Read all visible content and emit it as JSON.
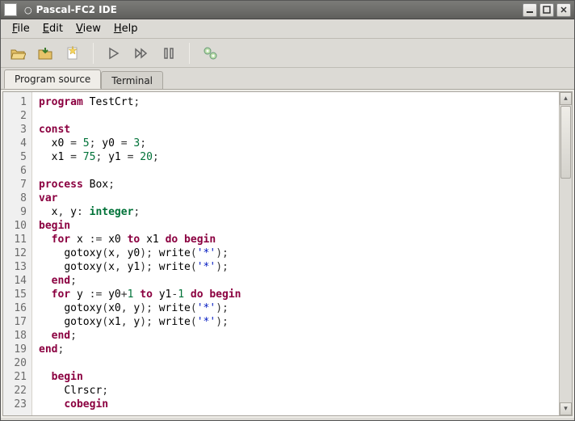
{
  "window": {
    "title": "Pascal-FC2 IDE"
  },
  "menu": {
    "file": "File",
    "edit": "Edit",
    "view": "View",
    "help": "Help"
  },
  "toolbar_icons": {
    "open": "folder-icon",
    "save": "save-icon",
    "new": "new-icon",
    "run": "play-icon",
    "fast": "fastforward-icon",
    "pause": "pause-icon",
    "settings": "gears-icon"
  },
  "tabs": {
    "source": "Program source",
    "terminal": "Terminal"
  },
  "code": {
    "lines": [
      {
        "n": "1",
        "tokens": [
          [
            "kw",
            "program"
          ],
          [
            "sp",
            " "
          ],
          [
            "id",
            "TestCrt"
          ],
          [
            "pun",
            ";"
          ]
        ]
      },
      {
        "n": "2",
        "tokens": []
      },
      {
        "n": "3",
        "tokens": [
          [
            "kw",
            "const"
          ]
        ]
      },
      {
        "n": "4",
        "tokens": [
          [
            "sp",
            "  "
          ],
          [
            "id",
            "x0"
          ],
          [
            "sp",
            " "
          ],
          [
            "pun",
            "="
          ],
          [
            "sp",
            " "
          ],
          [
            "num",
            "5"
          ],
          [
            "pun",
            ";"
          ],
          [
            "sp",
            " "
          ],
          [
            "id",
            "y0"
          ],
          [
            "sp",
            " "
          ],
          [
            "pun",
            "="
          ],
          [
            "sp",
            " "
          ],
          [
            "num",
            "3"
          ],
          [
            "pun",
            ";"
          ]
        ]
      },
      {
        "n": "5",
        "tokens": [
          [
            "sp",
            "  "
          ],
          [
            "id",
            "x1"
          ],
          [
            "sp",
            " "
          ],
          [
            "pun",
            "="
          ],
          [
            "sp",
            " "
          ],
          [
            "num",
            "75"
          ],
          [
            "pun",
            ";"
          ],
          [
            "sp",
            " "
          ],
          [
            "id",
            "y1"
          ],
          [
            "sp",
            " "
          ],
          [
            "pun",
            "="
          ],
          [
            "sp",
            " "
          ],
          [
            "num",
            "20"
          ],
          [
            "pun",
            ";"
          ]
        ]
      },
      {
        "n": "6",
        "tokens": []
      },
      {
        "n": "7",
        "tokens": [
          [
            "kw",
            "process"
          ],
          [
            "sp",
            " "
          ],
          [
            "id",
            "Box"
          ],
          [
            "pun",
            ";"
          ]
        ]
      },
      {
        "n": "8",
        "tokens": [
          [
            "kw",
            "var"
          ]
        ]
      },
      {
        "n": "9",
        "tokens": [
          [
            "sp",
            "  "
          ],
          [
            "id",
            "x"
          ],
          [
            "pun",
            ","
          ],
          [
            "sp",
            " "
          ],
          [
            "id",
            "y"
          ],
          [
            "pun",
            ":"
          ],
          [
            "sp",
            " "
          ],
          [
            "ty",
            "integer"
          ],
          [
            "pun",
            ";"
          ]
        ]
      },
      {
        "n": "10",
        "tokens": [
          [
            "kw",
            "begin"
          ]
        ]
      },
      {
        "n": "11",
        "tokens": [
          [
            "sp",
            "  "
          ],
          [
            "kw",
            "for"
          ],
          [
            "sp",
            " "
          ],
          [
            "id",
            "x"
          ],
          [
            "sp",
            " "
          ],
          [
            "pun",
            ":="
          ],
          [
            "sp",
            " "
          ],
          [
            "id",
            "x0"
          ],
          [
            "sp",
            " "
          ],
          [
            "kw",
            "to"
          ],
          [
            "sp",
            " "
          ],
          [
            "id",
            "x1"
          ],
          [
            "sp",
            " "
          ],
          [
            "kw",
            "do"
          ],
          [
            "sp",
            " "
          ],
          [
            "kw",
            "begin"
          ]
        ]
      },
      {
        "n": "12",
        "tokens": [
          [
            "sp",
            "    "
          ],
          [
            "id",
            "gotoxy"
          ],
          [
            "pun",
            "("
          ],
          [
            "id",
            "x"
          ],
          [
            "pun",
            ","
          ],
          [
            "sp",
            " "
          ],
          [
            "id",
            "y0"
          ],
          [
            "pun",
            ")"
          ],
          [
            "pun",
            ";"
          ],
          [
            "sp",
            " "
          ],
          [
            "id",
            "write"
          ],
          [
            "pun",
            "("
          ],
          [
            "str",
            "'*'"
          ],
          [
            "pun",
            ")"
          ],
          [
            "pun",
            ";"
          ]
        ]
      },
      {
        "n": "13",
        "tokens": [
          [
            "sp",
            "    "
          ],
          [
            "id",
            "gotoxy"
          ],
          [
            "pun",
            "("
          ],
          [
            "id",
            "x"
          ],
          [
            "pun",
            ","
          ],
          [
            "sp",
            " "
          ],
          [
            "id",
            "y1"
          ],
          [
            "pun",
            ")"
          ],
          [
            "pun",
            ";"
          ],
          [
            "sp",
            " "
          ],
          [
            "id",
            "write"
          ],
          [
            "pun",
            "("
          ],
          [
            "str",
            "'*'"
          ],
          [
            "pun",
            ")"
          ],
          [
            "pun",
            ";"
          ]
        ]
      },
      {
        "n": "14",
        "tokens": [
          [
            "sp",
            "  "
          ],
          [
            "kw",
            "end"
          ],
          [
            "pun",
            ";"
          ]
        ]
      },
      {
        "n": "15",
        "tokens": [
          [
            "sp",
            "  "
          ],
          [
            "kw",
            "for"
          ],
          [
            "sp",
            " "
          ],
          [
            "id",
            "y"
          ],
          [
            "sp",
            " "
          ],
          [
            "pun",
            ":="
          ],
          [
            "sp",
            " "
          ],
          [
            "id",
            "y0"
          ],
          [
            "pun",
            "+"
          ],
          [
            "num",
            "1"
          ],
          [
            "sp",
            " "
          ],
          [
            "kw",
            "to"
          ],
          [
            "sp",
            " "
          ],
          [
            "id",
            "y1"
          ],
          [
            "pun",
            "-"
          ],
          [
            "num",
            "1"
          ],
          [
            "sp",
            " "
          ],
          [
            "kw",
            "do"
          ],
          [
            "sp",
            " "
          ],
          [
            "kw",
            "begin"
          ]
        ]
      },
      {
        "n": "16",
        "tokens": [
          [
            "sp",
            "    "
          ],
          [
            "id",
            "gotoxy"
          ],
          [
            "pun",
            "("
          ],
          [
            "id",
            "x0"
          ],
          [
            "pun",
            ","
          ],
          [
            "sp",
            " "
          ],
          [
            "id",
            "y"
          ],
          [
            "pun",
            ")"
          ],
          [
            "pun",
            ";"
          ],
          [
            "sp",
            " "
          ],
          [
            "id",
            "write"
          ],
          [
            "pun",
            "("
          ],
          [
            "str",
            "'*'"
          ],
          [
            "pun",
            ")"
          ],
          [
            "pun",
            ";"
          ]
        ]
      },
      {
        "n": "17",
        "tokens": [
          [
            "sp",
            "    "
          ],
          [
            "id",
            "gotoxy"
          ],
          [
            "pun",
            "("
          ],
          [
            "id",
            "x1"
          ],
          [
            "pun",
            ","
          ],
          [
            "sp",
            " "
          ],
          [
            "id",
            "y"
          ],
          [
            "pun",
            ")"
          ],
          [
            "pun",
            ";"
          ],
          [
            "sp",
            " "
          ],
          [
            "id",
            "write"
          ],
          [
            "pun",
            "("
          ],
          [
            "str",
            "'*'"
          ],
          [
            "pun",
            ")"
          ],
          [
            "pun",
            ";"
          ]
        ]
      },
      {
        "n": "18",
        "tokens": [
          [
            "sp",
            "  "
          ],
          [
            "kw",
            "end"
          ],
          [
            "pun",
            ";"
          ]
        ]
      },
      {
        "n": "19",
        "tokens": [
          [
            "kw",
            "end"
          ],
          [
            "pun",
            ";"
          ]
        ]
      },
      {
        "n": "20",
        "tokens": []
      },
      {
        "n": "21",
        "tokens": [
          [
            "sp",
            "  "
          ],
          [
            "kw",
            "begin"
          ]
        ]
      },
      {
        "n": "22",
        "tokens": [
          [
            "sp",
            "    "
          ],
          [
            "id",
            "Clrscr"
          ],
          [
            "pun",
            ";"
          ]
        ]
      },
      {
        "n": "23",
        "tokens": [
          [
            "sp",
            "    "
          ],
          [
            "kw",
            "cobegin"
          ]
        ]
      }
    ]
  }
}
